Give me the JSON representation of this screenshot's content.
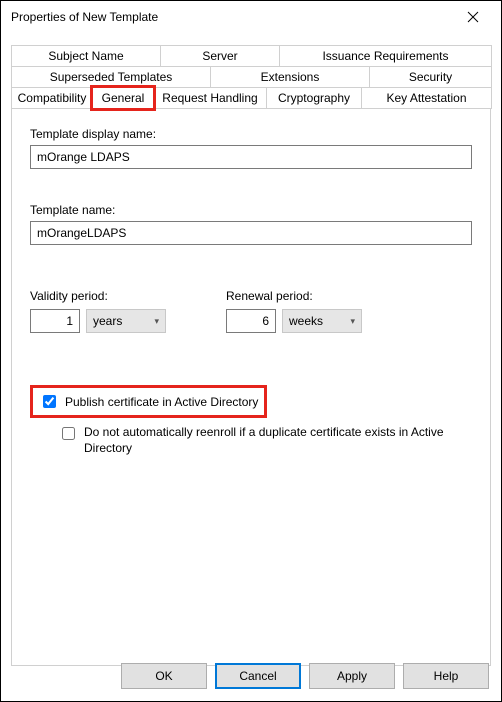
{
  "title": "Properties of New Template",
  "tabs": {
    "row1": [
      "Subject Name",
      "Server",
      "Issuance Requirements"
    ],
    "row2": [
      "Superseded Templates",
      "Extensions",
      "Security"
    ],
    "row3": [
      "Compatibility",
      "General",
      "Request Handling",
      "Cryptography",
      "Key Attestation"
    ]
  },
  "active_tab": "General",
  "fields": {
    "display_name_label": "Template display name:",
    "display_name_value": "mOrange LDAPS",
    "template_name_label": "Template name:",
    "template_name_value": "mOrangeLDAPS"
  },
  "validity": {
    "label": "Validity period:",
    "value": "1",
    "unit": "years"
  },
  "renewal": {
    "label": "Renewal period:",
    "value": "6",
    "unit": "weeks"
  },
  "checks": {
    "publish_label": "Publish certificate in Active Directory",
    "publish_checked": true,
    "reenroll_label": "Do not automatically reenroll if a duplicate certificate exists in Active Directory",
    "reenroll_checked": false
  },
  "buttons": {
    "ok": "OK",
    "cancel": "Cancel",
    "apply": "Apply",
    "help": "Help"
  }
}
